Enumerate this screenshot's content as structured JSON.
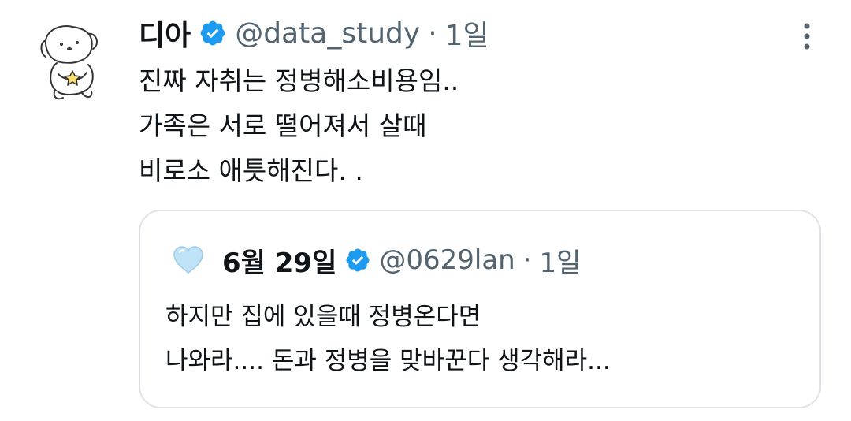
{
  "tweet": {
    "author_name": "디아",
    "handle": "@data_study",
    "separator": "·",
    "time": "1일",
    "avatar_icon": "puppy-holding-star-avatar",
    "verified_icon": "verified-badge-icon",
    "more_icon": "more-vertical-icon",
    "text_lines": [
      "진짜 자취는 정병해소비용임..",
      "가족은 서로 떨어져서 살때",
      "비로소 애틋해진다. ."
    ]
  },
  "quote": {
    "author_name": "6월 29일",
    "handle": "@0629lan",
    "separator": "·",
    "time": "1일",
    "avatar_icon": "light-blue-heart-icon",
    "verified_icon": "verified-badge-icon",
    "text_lines": [
      "하지만 집에 있을때 정병온다면",
      "나와라.... 돈과 정병을 맞바꾼다 생각해라..."
    ]
  },
  "colors": {
    "verified_blue": "#1d9bf0",
    "secondary_text": "#536471",
    "primary_text": "#0f1419",
    "border": "#dfe3e7",
    "heart": "#bfe3f7"
  }
}
